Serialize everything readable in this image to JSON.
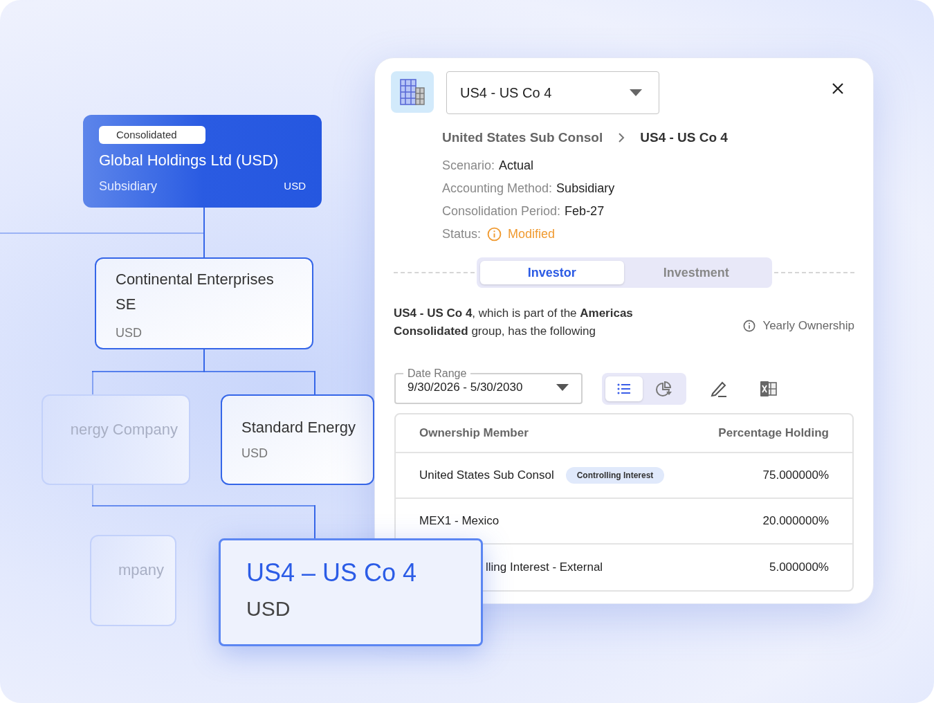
{
  "tree": {
    "nodes": [
      {
        "kind": "root",
        "badge": "Consolidated",
        "name": "Global Holdings Ltd (USD)",
        "method": "Subsidiary",
        "currency": "USD"
      },
      {
        "kind": "node",
        "name": "Continental Enterprises SE",
        "currency": "USD"
      },
      {
        "kind": "faded",
        "name": "nergy Company"
      },
      {
        "kind": "node",
        "name": "Standard Energy",
        "currency": "USD"
      },
      {
        "kind": "faded",
        "name": "mpany"
      },
      {
        "kind": "highlight",
        "name": "US4 – US Co 4",
        "currency": "USD"
      }
    ]
  },
  "panel": {
    "entity_select": {
      "value": "US4 - US Co 4"
    },
    "breadcrumb": [
      "United States Sub Consol",
      "US4 - US Co 4"
    ],
    "fields": [
      {
        "label": "Scenario:",
        "value": "Actual",
        "kind": "text"
      },
      {
        "label": "Accounting Method:",
        "value": "Subsidiary",
        "kind": "text"
      },
      {
        "label": "Consolidation Period:",
        "value": "Feb-27",
        "kind": "text"
      },
      {
        "label": "Status:",
        "value": "Modified",
        "kind": "status"
      }
    ],
    "tabs": [
      {
        "label": "Investor",
        "selected": true
      },
      {
        "label": "Investment",
        "selected": false
      }
    ],
    "description": "**US4 - US Co 4**, which is part of the **Americas Consolidated** group, has the following",
    "yearly_ownership": "Yearly Ownership",
    "date_range": {
      "label": "Date Range",
      "value": "9/30/2026 - 5/30/2030"
    },
    "view_toggle": [
      {
        "kind": "list",
        "selected": true
      },
      {
        "kind": "chart",
        "selected": false
      }
    ],
    "table": {
      "columns": [
        "Ownership Member",
        "Percentage Holding"
      ],
      "rows": [
        {
          "member": "United States Sub Consol",
          "badge": "Controlling Interest",
          "holding": "75.000000%",
          "partly_hidden": false
        },
        {
          "member": "MEX1 - Mexico",
          "holding": "20.000000%",
          "partly_hidden": false
        },
        {
          "member": "lling Interest - External",
          "holding": "5.000000%",
          "partly_hidden": true
        }
      ]
    }
  }
}
